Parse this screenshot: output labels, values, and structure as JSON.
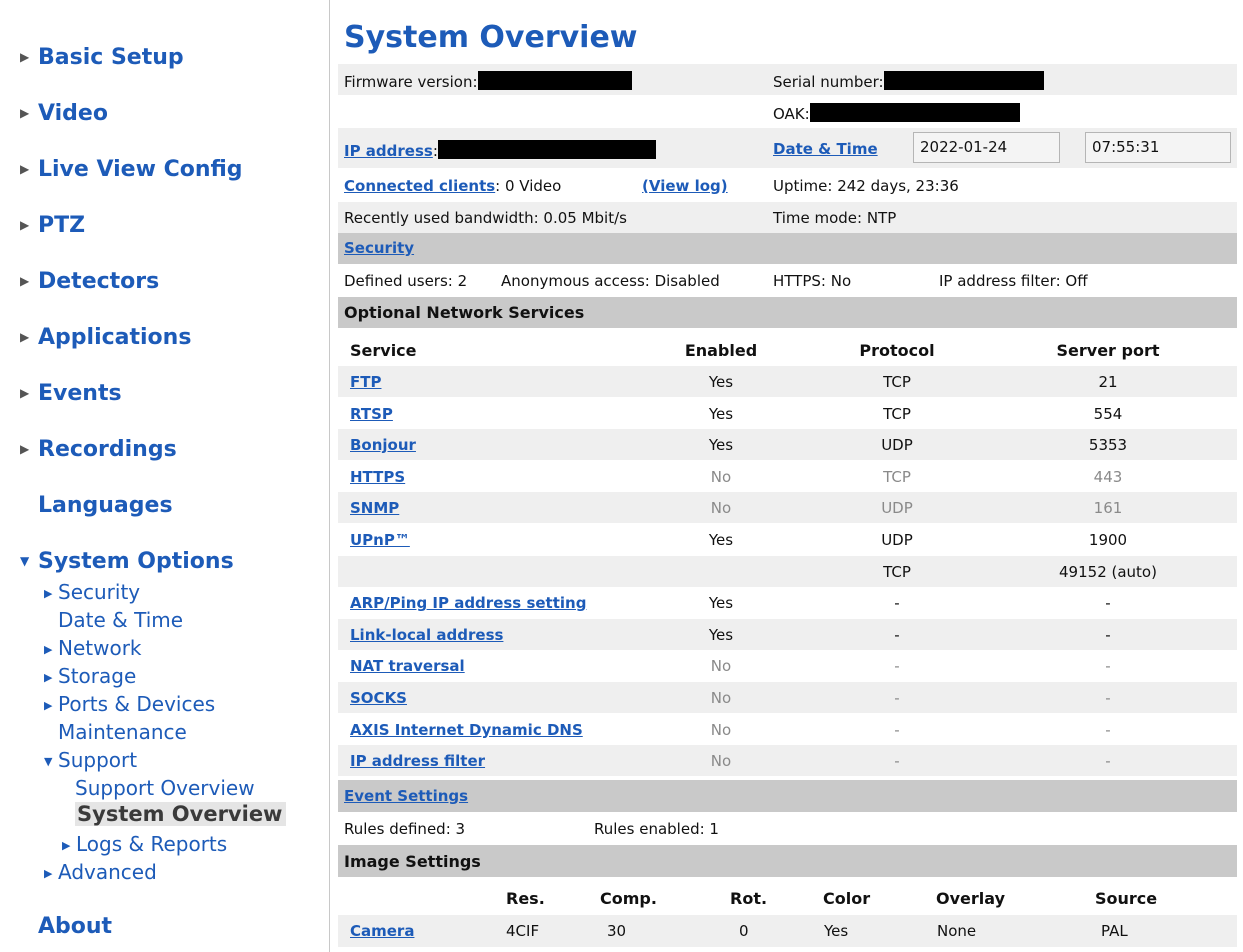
{
  "sidebar": {
    "basic_setup": "Basic Setup",
    "video": "Video",
    "live_view": "Live View Config",
    "ptz": "PTZ",
    "detectors": "Detectors",
    "applications": "Applications",
    "events": "Events",
    "recordings": "Recordings",
    "languages": "Languages",
    "system_options": "System Options",
    "security": "Security",
    "date_time": "Date & Time",
    "network": "Network",
    "storage": "Storage",
    "ports_devices": "Ports & Devices",
    "maintenance": "Maintenance",
    "support": "Support",
    "support_overview": "Support Overview",
    "system_overview": "System Overview",
    "logs_reports": "Logs & Reports",
    "advanced": "Advanced",
    "about": "About"
  },
  "main": {
    "title": "System Overview",
    "firmware_label": "Firmware version:",
    "serial_label": "Serial number:",
    "oak_label": "OAK:",
    "ip_link": "IP address",
    "colon": ":",
    "date_time_link": "Date & Time",
    "date_value": "2022-01-24",
    "time_value": "07:55:31",
    "connected_link": "Connected clients",
    "connected_value": ":  0  Video",
    "view_log": "(View log)",
    "uptime": "Uptime: 242 days, 23:36",
    "bandwidth": "Recently used bandwidth:  0.05 Mbit/s",
    "time_mode": "Time mode: NTP",
    "security_link": "Security",
    "defined_users": "Defined users: 2",
    "anonymous": "Anonymous access:  Disabled",
    "https": "HTTPS: No",
    "ip_filter": "IP address filter: Off",
    "services_header": "Optional Network Services",
    "col_service": "Service",
    "col_enabled": "Enabled",
    "col_protocol": "Protocol",
    "col_port": "Server port",
    "services": [
      {
        "name": "FTP",
        "enabled": "Yes",
        "protocol": "TCP",
        "port": "21"
      },
      {
        "name": "RTSP",
        "enabled": "Yes",
        "protocol": "TCP",
        "port": "554"
      },
      {
        "name": "Bonjour",
        "enabled": "Yes",
        "protocol": "UDP",
        "port": "5353"
      },
      {
        "name": "HTTPS",
        "enabled": "No",
        "protocol": "TCP",
        "port": "443"
      },
      {
        "name": "SNMP",
        "enabled": "No",
        "protocol": "UDP",
        "port": "161"
      },
      {
        "name": "UPnP™",
        "enabled": "Yes",
        "protocol": "UDP",
        "port": "1900"
      },
      {
        "name": "",
        "enabled": "",
        "protocol": "TCP",
        "port": "49152 (auto)"
      },
      {
        "name": "ARP/Ping IP address setting",
        "enabled": "Yes",
        "protocol": "-",
        "port": "-"
      },
      {
        "name": "Link-local address",
        "enabled": "Yes",
        "protocol": "-",
        "port": "-"
      },
      {
        "name": "NAT traversal",
        "enabled": "No",
        "protocol": "-",
        "port": "-"
      },
      {
        "name": "SOCKS",
        "enabled": "No",
        "protocol": "-",
        "port": "-"
      },
      {
        "name": "AXIS Internet Dynamic DNS",
        "enabled": "No",
        "protocol": "-",
        "port": "-"
      },
      {
        "name": "IP address filter",
        "enabled": "No",
        "protocol": "-",
        "port": "-"
      }
    ],
    "event_link": "Event Settings",
    "rules_defined": "Rules defined: 3",
    "rules_enabled": "Rules enabled: 1",
    "image_header": "Image Settings",
    "img_cols": {
      "res": "Res.",
      "comp": "Comp.",
      "rot": "Rot.",
      "color": "Color",
      "overlay": "Overlay",
      "source": "Source"
    },
    "camera": {
      "name": "Camera",
      "res": "4CIF",
      "comp": "30",
      "rot": "0",
      "color": "Yes",
      "overlay": "None",
      "source": "PAL"
    }
  }
}
